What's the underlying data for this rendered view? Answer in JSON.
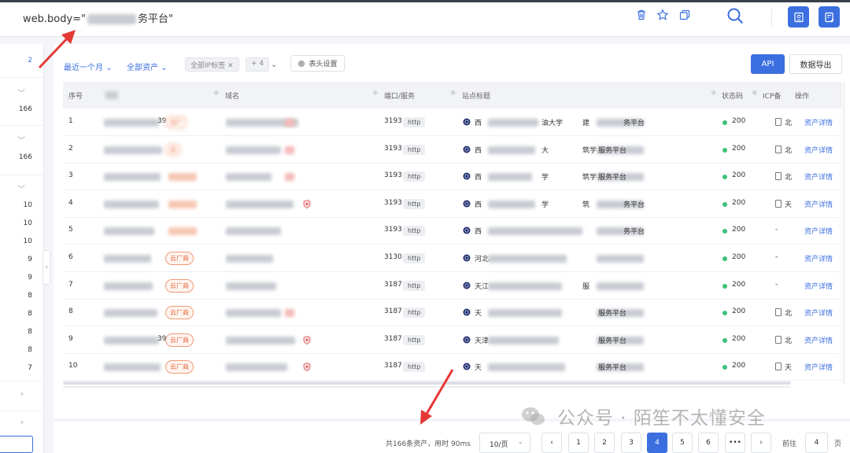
{
  "search": {
    "query_prefix": "web.body=\"",
    "query_suffix": "务平台\""
  },
  "sidebar": {
    "counts": [
      "2",
      "166",
      "166",
      "10",
      "10",
      "10",
      "9",
      "9",
      "8",
      "8",
      "8",
      "8",
      "7"
    ]
  },
  "filters": {
    "time": "最近一个月",
    "assets": "全部资产",
    "ip_tag_chip": "全部IP标签",
    "more_chip": "+ 4",
    "column_settings": "表头设置",
    "api_label": "API",
    "export_label": "数据导出"
  },
  "table": {
    "headers": {
      "index": "序号",
      "domain": "域名",
      "port_service": "端口/服务",
      "site_title": "站点标题",
      "status": "状态码",
      "icp": "ICP备",
      "action": "操作"
    },
    "rows": [
      {
        "index": "1",
        "ip_tail": "39",
        "cloud_tag": "云厂",
        "port": "3193",
        "service": "http",
        "title_head": "西",
        "title_mid": "油大学",
        "title_mid2": "建",
        "title_tail": "务平台",
        "status": "200",
        "icp": "北",
        "action": "资产详情"
      },
      {
        "index": "2",
        "ip_tail": "",
        "cloud_tag": "云",
        "port": "3193",
        "service": "http",
        "title_head": "西",
        "title_mid": "大",
        "title_mid2": "筑学",
        "title_tail": "服务平台",
        "status": "200",
        "icp": "北",
        "action": "资产详情"
      },
      {
        "index": "3",
        "ip_tail": "",
        "cloud_tag": "",
        "port": "3193",
        "service": "http",
        "title_head": "西",
        "title_mid": "学",
        "title_mid2": "筑学",
        "title_tail": "服务平台",
        "status": "200",
        "icp": "北",
        "action": "资产详情"
      },
      {
        "index": "4",
        "ip_tail": "",
        "cloud_tag": "",
        "port": "3193",
        "service": "http",
        "title_head": "西",
        "title_mid": "学",
        "title_mid2": "筑",
        "title_tail": "务平台",
        "status": "200",
        "icp": "天",
        "action": "资产详情"
      },
      {
        "index": "5",
        "ip_tail": "",
        "cloud_tag": "",
        "port": "3193",
        "service": "http",
        "title_head": "西",
        "title_mid": "",
        "title_mid2": "",
        "title_tail": "务平台",
        "status": "200",
        "icp": "-",
        "action": "资产详情"
      },
      {
        "index": "6",
        "ip_tail": "",
        "cloud_tag": "云厂商",
        "port": "3130",
        "service": "http",
        "title_head": "河北",
        "title_mid": "",
        "title_mid2": "",
        "title_tail": "",
        "status": "200",
        "icp": "-",
        "action": "资产详情"
      },
      {
        "index": "7",
        "ip_tail": "",
        "cloud_tag": "云厂商",
        "port": "3187",
        "service": "http",
        "title_head": "天江",
        "title_mid": "",
        "title_mid2": "服",
        "title_tail": "",
        "status": "200",
        "icp": "-",
        "action": "资产详情"
      },
      {
        "index": "8",
        "ip_tail": "",
        "cloud_tag": "云厂商",
        "port": "3187",
        "service": "http",
        "title_head": "天",
        "title_mid": "",
        "title_mid2": "",
        "title_tail": "服务平台",
        "status": "200",
        "icp": "北",
        "action": "资产详情"
      },
      {
        "index": "9",
        "ip_tail": "39",
        "cloud_tag": "云厂商",
        "port": "3187",
        "service": "http",
        "title_head": "天津",
        "title_mid": "",
        "title_mid2": "",
        "title_tail": "服务平台",
        "status": "200",
        "icp": "北",
        "action": "资产详情"
      },
      {
        "index": "10",
        "ip_tail": "",
        "cloud_tag": "云厂商",
        "port": "3187",
        "service": "http",
        "title_head": "天",
        "title_mid": "",
        "title_mid2": "",
        "title_tail": "服务平台",
        "status": "200",
        "icp": "天",
        "action": "资产详情"
      }
    ]
  },
  "pagination": {
    "total": "共166条资产，用时 90ms",
    "page_size": "10/页",
    "pages": [
      "1",
      "2",
      "3",
      "4",
      "5",
      "6"
    ],
    "current_page": "4",
    "ellipsis": "•••",
    "goto_label": "前往",
    "goto_value": "4",
    "page_unit": "页"
  },
  "watermark": {
    "text": "公众号 · 陌笙不太懂安全"
  },
  "colors": {
    "accent": "#3b6fe0",
    "cloud_tag": "#e8663c",
    "status_ok": "#3bc17a"
  }
}
